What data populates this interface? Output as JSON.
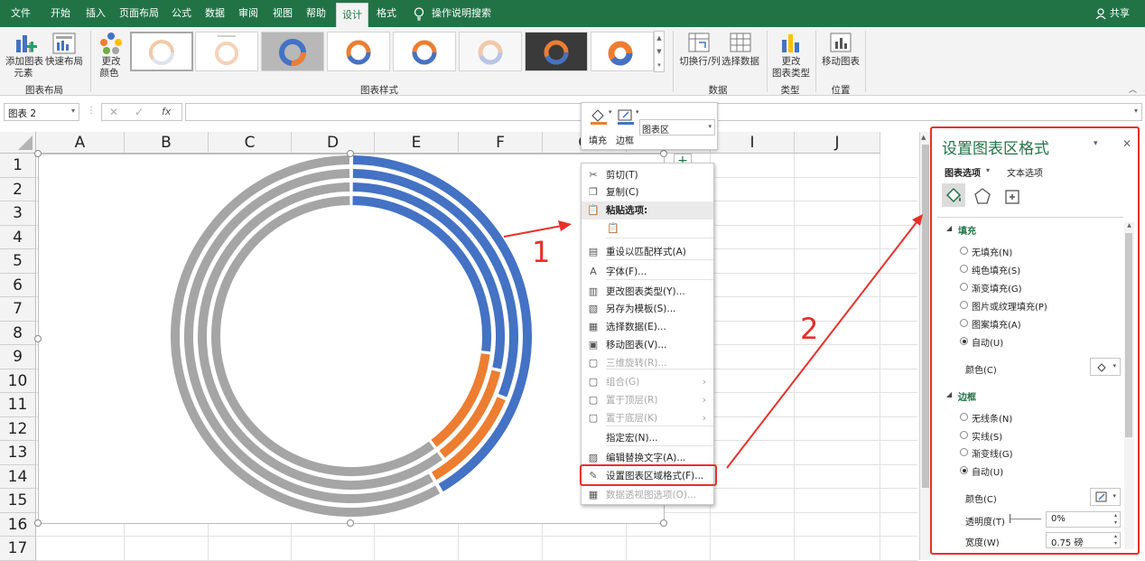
{
  "tabs": [
    "文件",
    "开始",
    "插入",
    "页面布局",
    "公式",
    "数据",
    "审阅",
    "视图",
    "帮助",
    "设计",
    "格式",
    "操作说明搜索"
  ],
  "share": "共享",
  "ribbon": {
    "add_element": "添加图表",
    "add_element2": "元素",
    "quick_layout": "快速布局",
    "change_colors": "更改",
    "change_colors2": "颜色",
    "group_layout": "图表布局",
    "group_styles": "图表样式",
    "switch_rowcol": "切换行/列",
    "select_data": "选择数据",
    "group_data": "数据",
    "change_type": "更改",
    "change_type2": "图表类型",
    "group_type": "类型",
    "move_chart": "移动图表",
    "group_location": "位置"
  },
  "formula": {
    "name_box": "图表 2",
    "fx": "fx"
  },
  "columns": [
    "A",
    "B",
    "C",
    "D",
    "E",
    "F",
    "G",
    "H",
    "I",
    "J"
  ],
  "rows": [
    "1",
    "2",
    "3",
    "4",
    "5",
    "6",
    "7",
    "8",
    "9",
    "10",
    "11",
    "12",
    "13",
    "14",
    "15",
    "16",
    "17"
  ],
  "mini_toolbar": {
    "fill": "填充",
    "border": "边框",
    "dropdown": "图表区"
  },
  "context_menu": [
    {
      "label": "剪切(T)",
      "icon": "scissors-icon",
      "glyph": "✂",
      "disabled": false
    },
    {
      "label": "复制(C)",
      "icon": "copy-icon",
      "glyph": "❐",
      "disabled": false
    },
    {
      "label": "粘贴选项:",
      "icon": "paste-icon",
      "glyph": "📋",
      "disabled": false
    },
    {
      "label": "",
      "icon": "paste-option-icon",
      "glyph": "📋",
      "disabled": true
    },
    {
      "label": "重设以匹配样式(A)",
      "icon": "reset-style-icon",
      "glyph": "▤",
      "disabled": false
    },
    {
      "label": "字体(F)...",
      "icon": "font-icon",
      "glyph": "A",
      "disabled": false
    },
    {
      "label": "更改图表类型(Y)...",
      "icon": "chart-type-icon",
      "glyph": "▥",
      "disabled": false
    },
    {
      "label": "另存为模板(S)...",
      "icon": "save-template-icon",
      "glyph": "▧",
      "disabled": false
    },
    {
      "label": "选择数据(E)...",
      "icon": "select-data-icon",
      "glyph": "▦",
      "disabled": false
    },
    {
      "label": "移动图表(V)...",
      "icon": "move-chart-icon",
      "glyph": "▣",
      "disabled": false
    },
    {
      "label": "三维旋转(R)...",
      "icon": "rotate-3d-icon",
      "glyph": "▢",
      "disabled": true
    },
    {
      "label": "组合(G)",
      "icon": "group-icon",
      "glyph": "▢",
      "disabled": true,
      "sub": true
    },
    {
      "label": "置于顶层(R)",
      "icon": "bring-front-icon",
      "glyph": "▢",
      "disabled": true,
      "sub": true
    },
    {
      "label": "置于底层(K)",
      "icon": "send-back-icon",
      "glyph": "▢",
      "disabled": true,
      "sub": true
    },
    {
      "label": "指定宏(N)...",
      "icon": "macro-icon",
      "glyph": "",
      "disabled": false
    },
    {
      "label": "编辑替换文字(A)...",
      "icon": "alt-text-icon",
      "glyph": "▨",
      "disabled": false
    },
    {
      "label": "设置图表区域格式(F)...",
      "icon": "format-chart-icon",
      "glyph": "✎",
      "disabled": false
    },
    {
      "label": "数据透视图选项(O)...",
      "icon": "pivot-options-icon",
      "glyph": "▦",
      "disabled": true
    }
  ],
  "annotations": {
    "step1": "1",
    "step2": "2"
  },
  "panel": {
    "title": "设置图表区格式",
    "tab_chart": "图表选项",
    "tab_text": "文本选项",
    "fill_header": "填充",
    "fill_options": [
      "无填充(N)",
      "纯色填充(S)",
      "渐变填充(G)",
      "图片或纹理填充(P)",
      "图案填充(A)",
      "自动(U)"
    ],
    "fill_selected": 5,
    "color_label": "颜色(C)",
    "border_header": "边框",
    "border_options": [
      "无线条(N)",
      "实线(S)",
      "渐变线(G)",
      "自动(U)"
    ],
    "border_selected": 3,
    "border_color_label": "颜色(C)",
    "transparency_label": "透明度(T)",
    "transparency_value": "0%",
    "width_label": "宽度(W)",
    "width_value": "0.75 磅"
  },
  "colors": {
    "excel_green": "#217346",
    "blue": "#4472c4",
    "orange": "#ed7d31",
    "gray": "#a5a5a5",
    "red": "#e8302a"
  }
}
